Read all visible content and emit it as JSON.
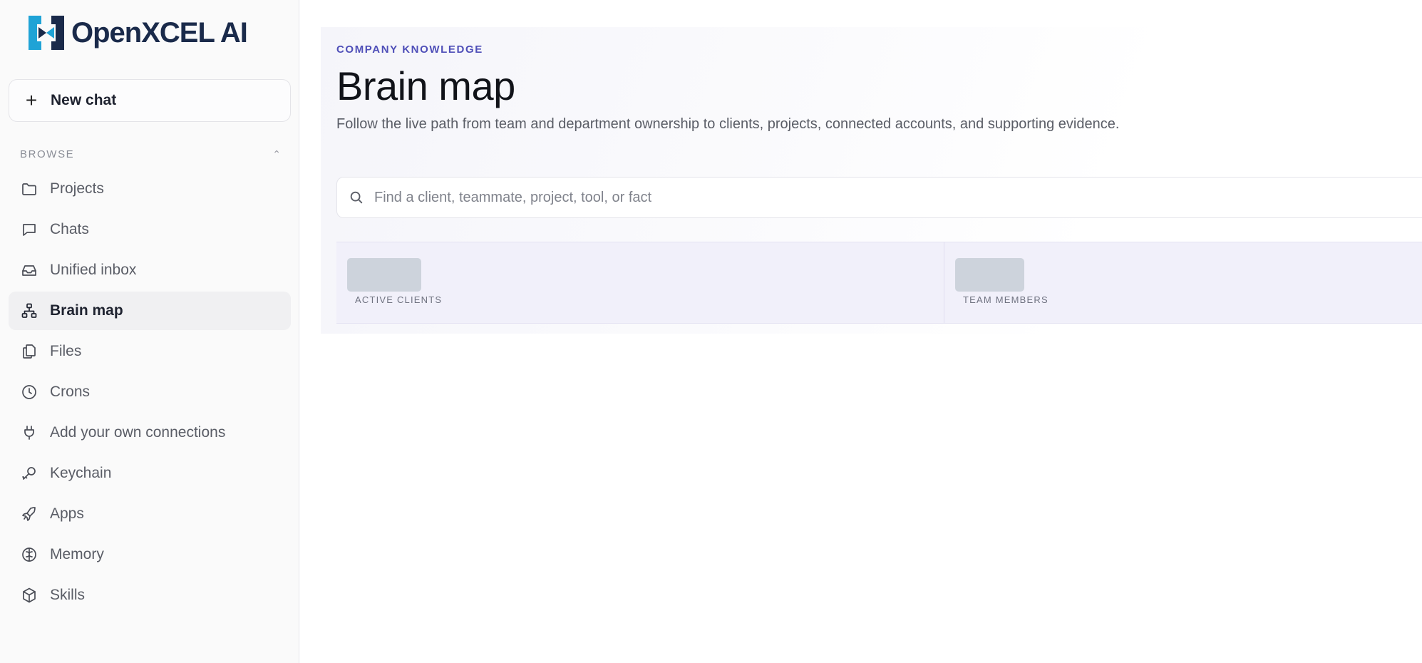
{
  "brand": {
    "name": "OpenXCEL AI",
    "primary_color": "#1a2a4a",
    "accent_color": "#1fa3d6"
  },
  "sidebar": {
    "new_chat_label": "New chat",
    "browse_label": "BROWSE",
    "items": [
      {
        "label": "Projects",
        "icon": "folder-icon"
      },
      {
        "label": "Chats",
        "icon": "chat-bubble-icon"
      },
      {
        "label": "Unified inbox",
        "icon": "inbox-icon"
      },
      {
        "label": "Brain map",
        "icon": "network-icon",
        "active": true
      },
      {
        "label": "Files",
        "icon": "files-icon"
      },
      {
        "label": "Crons",
        "icon": "clock-icon"
      },
      {
        "label": "Add your own connections",
        "icon": "plug-icon"
      },
      {
        "label": "Keychain",
        "icon": "key-icon"
      },
      {
        "label": "Apps",
        "icon": "rocket-icon"
      },
      {
        "label": "Memory",
        "icon": "brain-icon"
      },
      {
        "label": "Skills",
        "icon": "cube-icon"
      }
    ]
  },
  "main": {
    "eyebrow": "COMPANY KNOWLEDGE",
    "title": "Brain map",
    "subtitle": "Follow the live path from team and department ownership to clients, projects, connected accounts, and supporting evidence.",
    "search": {
      "placeholder": "Find a client, teammate, project, tool, or fact",
      "value": ""
    },
    "stats": [
      {
        "label": "ACTIVE CLIENTS",
        "value_state": "loading"
      },
      {
        "label": "TEAM MEMBERS",
        "value_state": "loading"
      }
    ]
  }
}
